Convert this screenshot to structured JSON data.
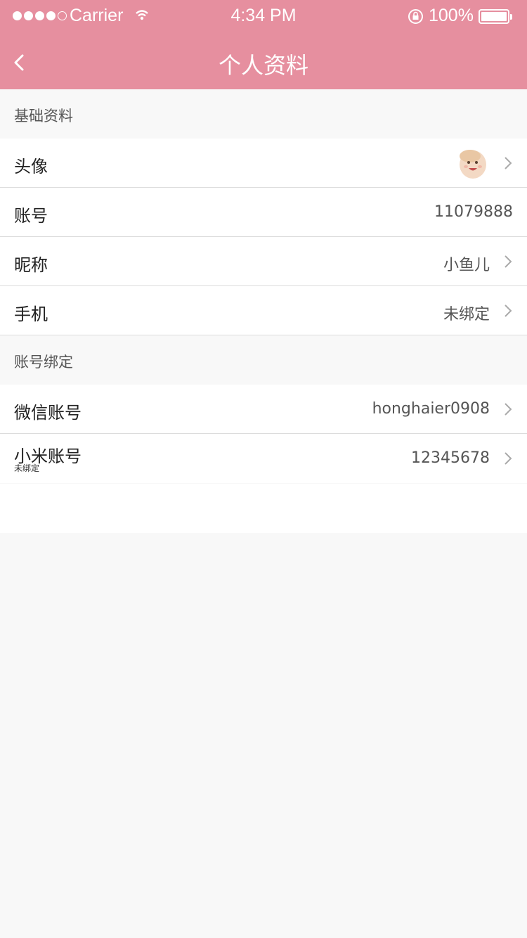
{
  "status_bar": {
    "carrier": "Carrier",
    "time": "4:34 PM",
    "battery": "100%",
    "signal_bars": 4,
    "signal_total": 5
  },
  "nav": {
    "title": "个人资料",
    "back_icon": "chevron-left-icon"
  },
  "sections": [
    {
      "title": "基础资料",
      "rows": [
        {
          "label": "头像",
          "value": "",
          "type": "avatar",
          "arrow": true
        },
        {
          "label": "账号",
          "value": "11079888",
          "arrow": false
        },
        {
          "label": "昵称",
          "value": "小鱼儿",
          "arrow": true
        },
        {
          "label": "手机",
          "value": "未绑定",
          "arrow": true
        }
      ]
    },
    {
      "title": "账号绑定",
      "rows": [
        {
          "label": "微信账号",
          "value": "honghaier0908",
          "arrow": true
        },
        {
          "label": "小米账号",
          "sublabel": "未绑定",
          "value": "12345678",
          "arrow": true
        }
      ]
    }
  ],
  "colors": {
    "header_bg": "#e68f9f",
    "page_bg": "#f8f8f8"
  }
}
